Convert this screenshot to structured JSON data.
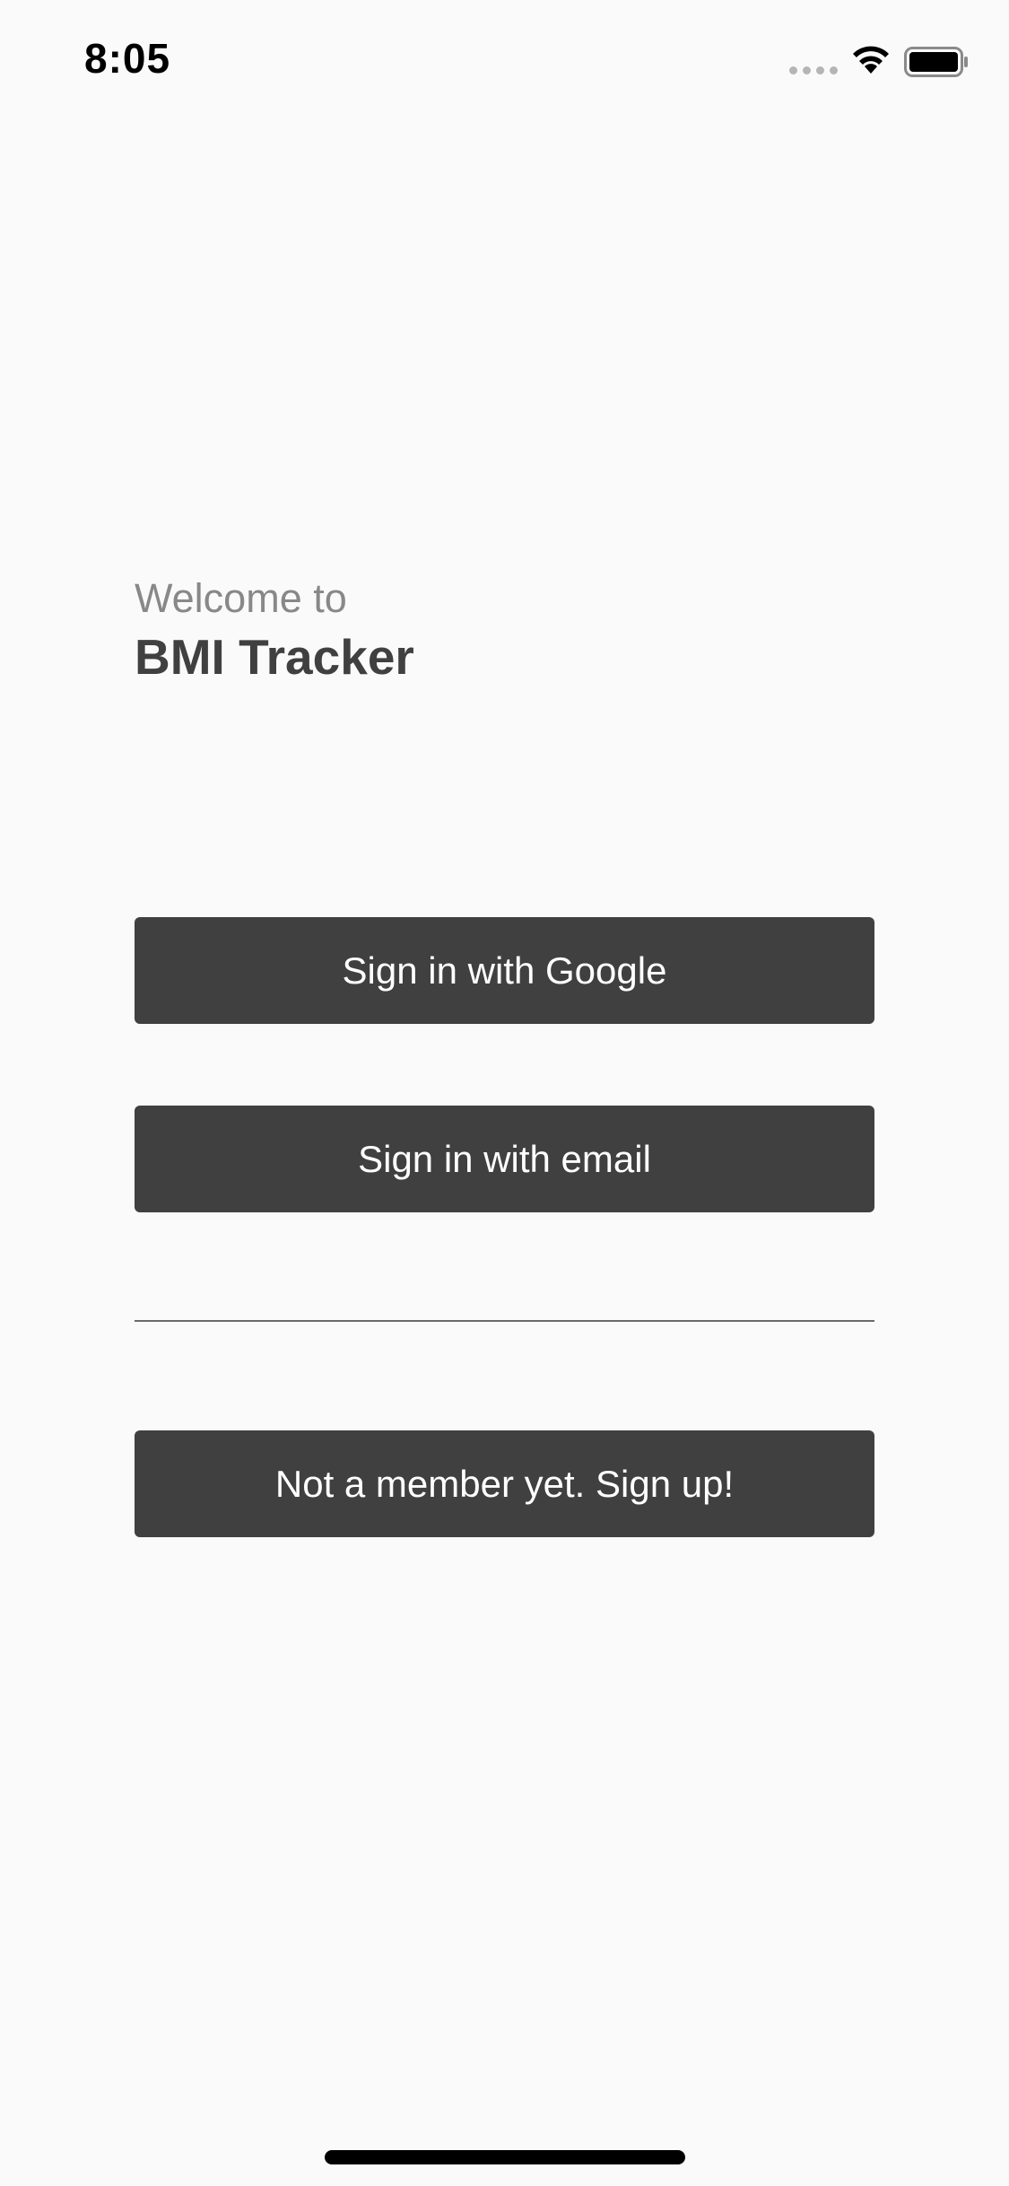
{
  "status_bar": {
    "time": "8:05",
    "icons": [
      "cellular-signal-icon",
      "wifi-icon",
      "battery-icon"
    ]
  },
  "welcome": {
    "subtitle": "Welcome to",
    "app_name": "BMI Tracker"
  },
  "actions": {
    "google_label": "Sign in with Google",
    "email_label": "Sign in with email",
    "signup_label": "Not a member yet. Sign up!"
  },
  "colors": {
    "background": "#fafafa",
    "button": "#404040",
    "button_text": "#ffffff",
    "subtitle": "#888888",
    "title": "#404040"
  }
}
